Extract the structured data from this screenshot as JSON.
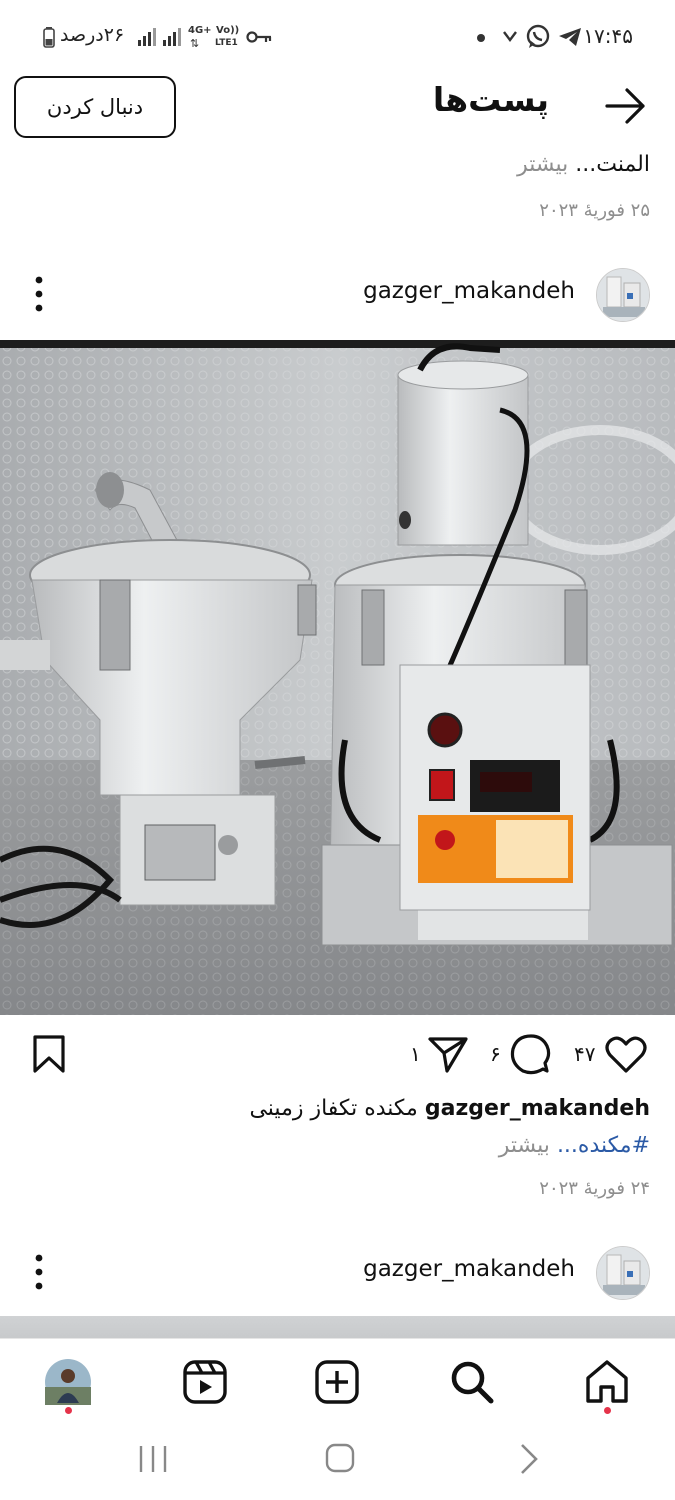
{
  "status_bar": {
    "time": "۱۷:۴۵",
    "battery_text": "۲۶درصد",
    "network_labels": [
      "4G+",
      "Vo))",
      "LTE1"
    ]
  },
  "header": {
    "title": "پست‌ها",
    "follow_label": "دنبال کردن"
  },
  "previous_post": {
    "caption_tail": "المنت...",
    "more_label": "بیشتر",
    "date": "۲۵ فوریهٔ ۲۰۲۳"
  },
  "post": {
    "username": "gazger_makandeh",
    "likes": "۴۷",
    "comments": "۶",
    "shares": "۱",
    "caption_username": "gazger_makandeh",
    "caption_text": "مکنده تکفاز زمینی",
    "hashtag": "#مکنده...",
    "more_label": "بیشتر",
    "date": "۲۴ فوریهٔ ۲۰۲۳"
  },
  "next_post": {
    "username": "gazger_makandeh"
  },
  "icons": {
    "back": "arrow-right-icon",
    "menu": "more-vertical-icon",
    "like": "heart-icon",
    "comment": "comment-icon",
    "share": "send-icon",
    "save": "bookmark-icon",
    "nav": [
      "home-icon",
      "search-icon",
      "create-icon",
      "reels-icon",
      "profile-avatar"
    ]
  },
  "colors": {
    "hashtag": "#2b5aa6",
    "muted": "#8e8e8e",
    "notification_dot": "#e5334a"
  }
}
